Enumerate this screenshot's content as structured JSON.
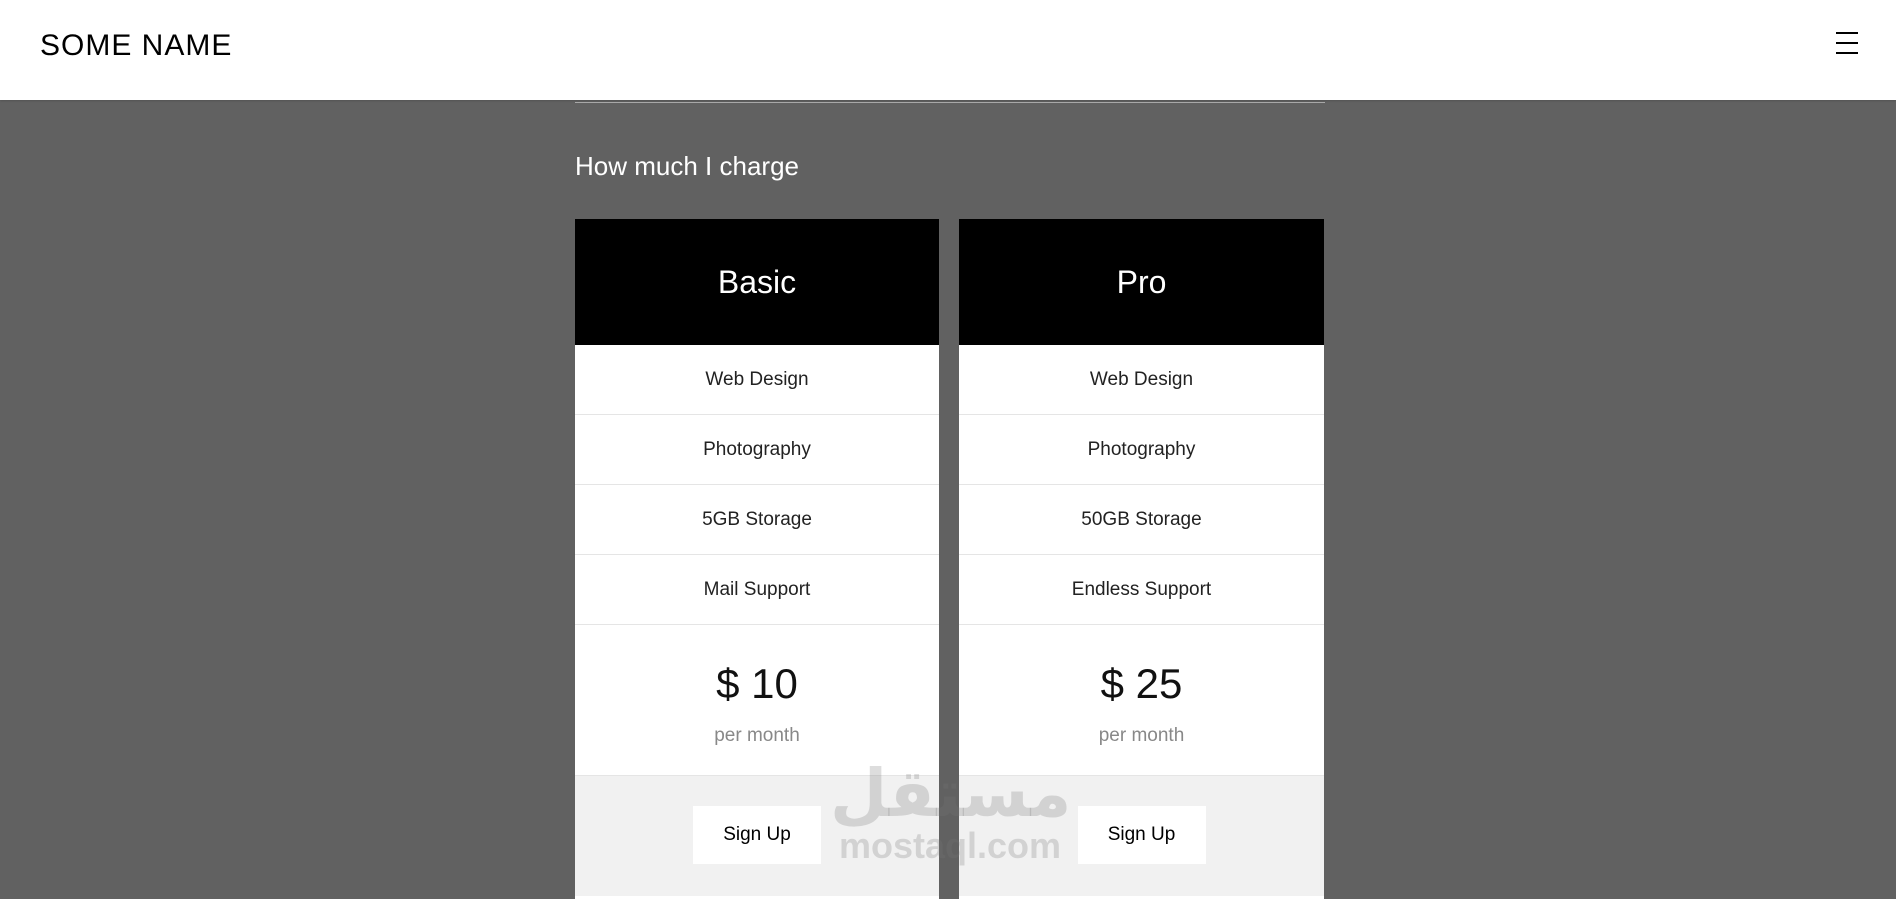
{
  "header": {
    "brand": "SOME NAME",
    "menu_icon": "hamburger-menu-icon"
  },
  "section": {
    "title": "How much I charge"
  },
  "plans": [
    {
      "name": "Basic",
      "features": [
        "Web Design",
        "Photography",
        "5GB Storage",
        "Mail Support"
      ],
      "price": "$ 10",
      "period": "per month",
      "button": "Sign Up"
    },
    {
      "name": "Pro",
      "features": [
        "Web Design",
        "Photography",
        "50GB Storage",
        "Endless Support"
      ],
      "price": "$ 25",
      "period": "per month",
      "button": "Sign Up"
    }
  ],
  "watermark": {
    "arabic": "مستقل",
    "latin": "mostaql.com"
  },
  "colors": {
    "page_background": "#616161",
    "header_background": "#ffffff",
    "card_header": "#000000",
    "card_footer": "#f1f1f1"
  }
}
